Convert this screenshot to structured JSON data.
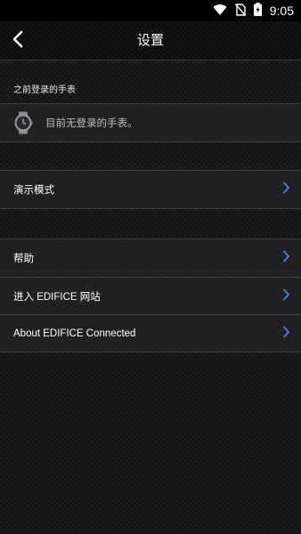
{
  "status_bar": {
    "time": "9:05"
  },
  "app_bar": {
    "title": "设置"
  },
  "previous_watches": {
    "header": "之前登录的手表",
    "empty_text": "目前无登录的手表。"
  },
  "groups": {
    "demo": {
      "label": "演示模式"
    },
    "help": {
      "label": "帮助"
    },
    "website": {
      "label": "进入 EDIFICE 网站"
    },
    "about": {
      "label": "About EDIFICE Connected"
    }
  },
  "colors": {
    "chevron": "#3d86f0",
    "background": "#141414"
  }
}
